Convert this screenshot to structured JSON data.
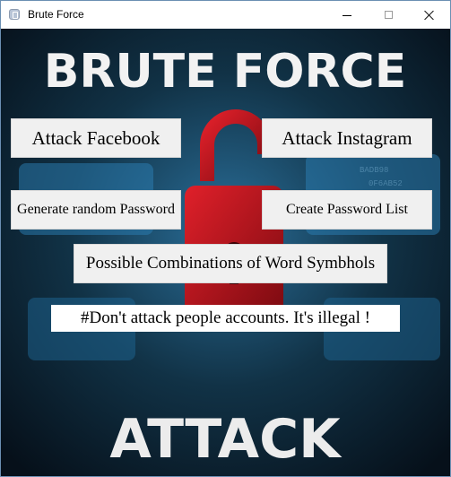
{
  "window": {
    "title": "Brute Force",
    "icon": "app-icon",
    "controls": [
      "minimize-icon",
      "maximize-icon",
      "close-icon"
    ]
  },
  "background": {
    "headline": "BRUTE FORCE",
    "footer": "ATTACK",
    "colors": {
      "lock": "#c8101a",
      "headline": "#f2f2f2",
      "dark": "#0a1620",
      "glow": "#3fa0d8"
    }
  },
  "buttons": {
    "attack_facebook": "Attack Facebook",
    "attack_instagram": "Attack Instagram",
    "generate_password": "Generate random Password",
    "create_list": "Create Password List",
    "combinations": "Possible Combinations of Word Symbhols"
  },
  "warning": "#Don't attack people accounts. It's illegal !"
}
